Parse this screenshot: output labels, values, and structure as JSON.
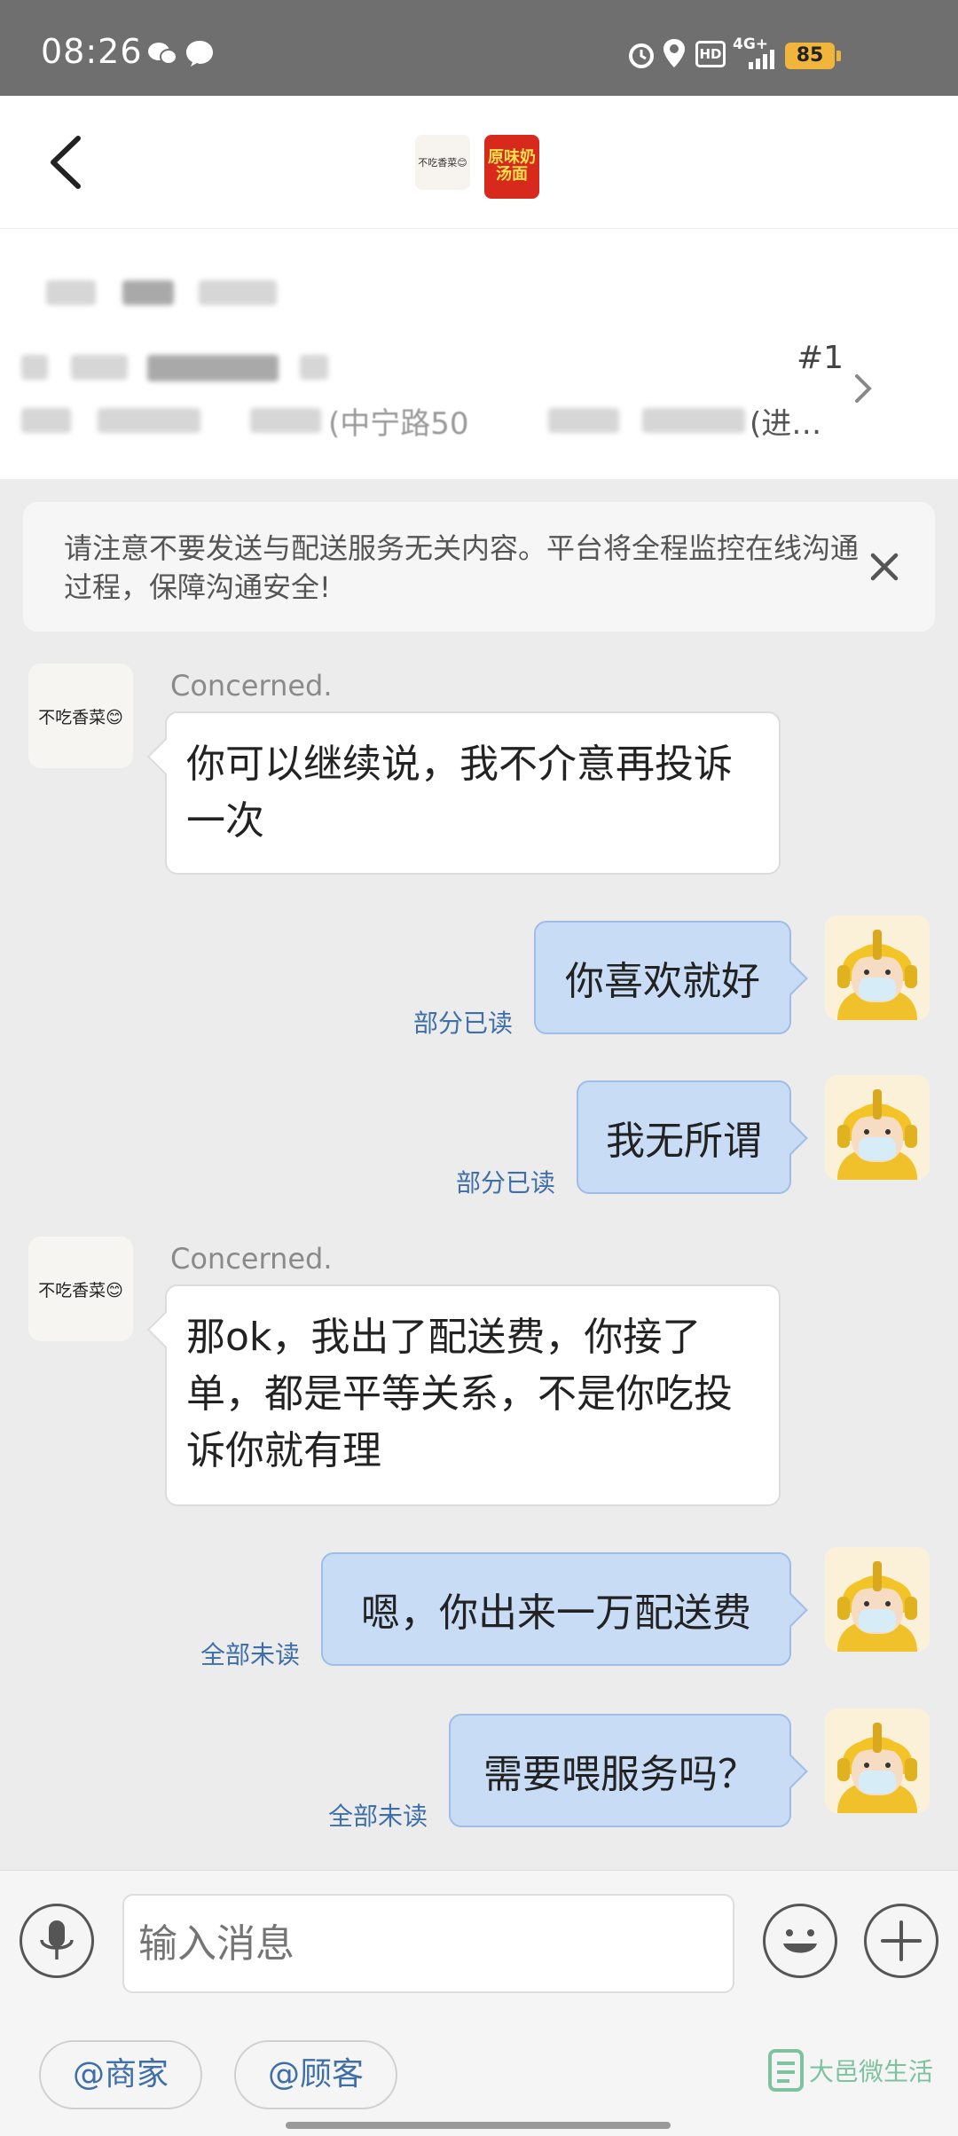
{
  "status_bar": {
    "time": "08:26",
    "network": "4G+",
    "hd": "HD",
    "battery": "85"
  },
  "header": {
    "avatar1_label": "不吃香菜😊",
    "avatar2_label": "原味奶汤面"
  },
  "order": {
    "number": "#1",
    "address_partial": "(中宁路50",
    "address_end": "(进…"
  },
  "notice": {
    "text": "请注意不要发送与配送服务无关内容。平台将全程监控在线沟通过程，保障沟通安全!"
  },
  "messages": [
    {
      "side": "in",
      "sender": "Concerned.",
      "avatar_label": "不吃香菜😊",
      "text": "你可以继续说，我不介意再投诉一次"
    },
    {
      "side": "out",
      "text": "你喜欢就好",
      "status": "部分已读"
    },
    {
      "side": "out",
      "text": "我无所谓",
      "status": "部分已读"
    },
    {
      "side": "in",
      "sender": "Concerned.",
      "avatar_label": "不吃香菜😊",
      "text": "那ok，我出了配送费，你接了单，都是平等关系，不是你吃投诉你就有理"
    },
    {
      "side": "out",
      "text": "嗯，你出来一万配送费",
      "status": "全部未读"
    },
    {
      "side": "out",
      "text": "需要喂服务吗？",
      "status": "全部未读"
    }
  ],
  "input": {
    "placeholder": "输入消息"
  },
  "mentions": {
    "merchant": "@商家",
    "customer": "@顾客"
  },
  "watermark": {
    "name": "大邑微生活"
  }
}
